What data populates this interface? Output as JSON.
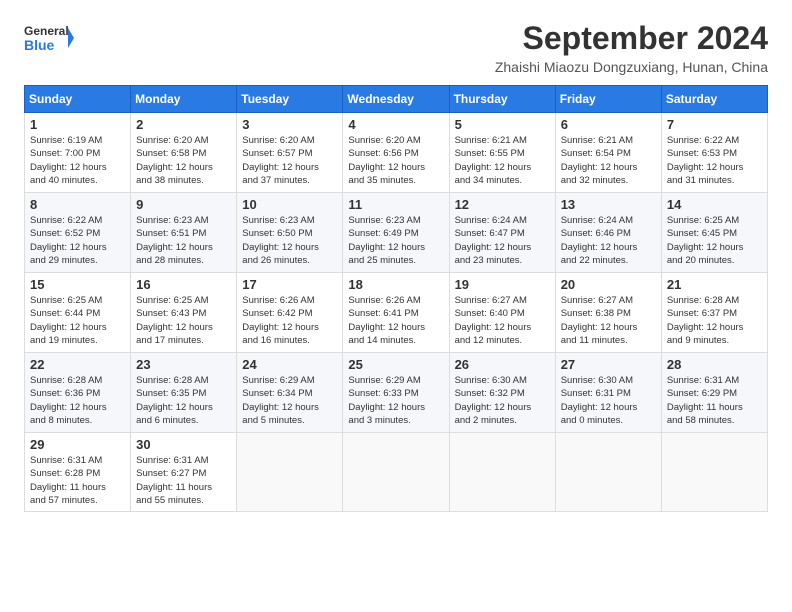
{
  "header": {
    "logo_general": "General",
    "logo_blue": "Blue",
    "month_title": "September 2024",
    "location": "Zhaishi Miaozu Dongzuxiang, Hunan, China"
  },
  "days_of_week": [
    "Sunday",
    "Monday",
    "Tuesday",
    "Wednesday",
    "Thursday",
    "Friday",
    "Saturday"
  ],
  "weeks": [
    [
      {
        "day": "1",
        "info": "Sunrise: 6:19 AM\nSunset: 7:00 PM\nDaylight: 12 hours\nand 40 minutes."
      },
      {
        "day": "2",
        "info": "Sunrise: 6:20 AM\nSunset: 6:58 PM\nDaylight: 12 hours\nand 38 minutes."
      },
      {
        "day": "3",
        "info": "Sunrise: 6:20 AM\nSunset: 6:57 PM\nDaylight: 12 hours\nand 37 minutes."
      },
      {
        "day": "4",
        "info": "Sunrise: 6:20 AM\nSunset: 6:56 PM\nDaylight: 12 hours\nand 35 minutes."
      },
      {
        "day": "5",
        "info": "Sunrise: 6:21 AM\nSunset: 6:55 PM\nDaylight: 12 hours\nand 34 minutes."
      },
      {
        "day": "6",
        "info": "Sunrise: 6:21 AM\nSunset: 6:54 PM\nDaylight: 12 hours\nand 32 minutes."
      },
      {
        "day": "7",
        "info": "Sunrise: 6:22 AM\nSunset: 6:53 PM\nDaylight: 12 hours\nand 31 minutes."
      }
    ],
    [
      {
        "day": "8",
        "info": "Sunrise: 6:22 AM\nSunset: 6:52 PM\nDaylight: 12 hours\nand 29 minutes."
      },
      {
        "day": "9",
        "info": "Sunrise: 6:23 AM\nSunset: 6:51 PM\nDaylight: 12 hours\nand 28 minutes."
      },
      {
        "day": "10",
        "info": "Sunrise: 6:23 AM\nSunset: 6:50 PM\nDaylight: 12 hours\nand 26 minutes."
      },
      {
        "day": "11",
        "info": "Sunrise: 6:23 AM\nSunset: 6:49 PM\nDaylight: 12 hours\nand 25 minutes."
      },
      {
        "day": "12",
        "info": "Sunrise: 6:24 AM\nSunset: 6:47 PM\nDaylight: 12 hours\nand 23 minutes."
      },
      {
        "day": "13",
        "info": "Sunrise: 6:24 AM\nSunset: 6:46 PM\nDaylight: 12 hours\nand 22 minutes."
      },
      {
        "day": "14",
        "info": "Sunrise: 6:25 AM\nSunset: 6:45 PM\nDaylight: 12 hours\nand 20 minutes."
      }
    ],
    [
      {
        "day": "15",
        "info": "Sunrise: 6:25 AM\nSunset: 6:44 PM\nDaylight: 12 hours\nand 19 minutes."
      },
      {
        "day": "16",
        "info": "Sunrise: 6:25 AM\nSunset: 6:43 PM\nDaylight: 12 hours\nand 17 minutes."
      },
      {
        "day": "17",
        "info": "Sunrise: 6:26 AM\nSunset: 6:42 PM\nDaylight: 12 hours\nand 16 minutes."
      },
      {
        "day": "18",
        "info": "Sunrise: 6:26 AM\nSunset: 6:41 PM\nDaylight: 12 hours\nand 14 minutes."
      },
      {
        "day": "19",
        "info": "Sunrise: 6:27 AM\nSunset: 6:40 PM\nDaylight: 12 hours\nand 12 minutes."
      },
      {
        "day": "20",
        "info": "Sunrise: 6:27 AM\nSunset: 6:38 PM\nDaylight: 12 hours\nand 11 minutes."
      },
      {
        "day": "21",
        "info": "Sunrise: 6:28 AM\nSunset: 6:37 PM\nDaylight: 12 hours\nand 9 minutes."
      }
    ],
    [
      {
        "day": "22",
        "info": "Sunrise: 6:28 AM\nSunset: 6:36 PM\nDaylight: 12 hours\nand 8 minutes."
      },
      {
        "day": "23",
        "info": "Sunrise: 6:28 AM\nSunset: 6:35 PM\nDaylight: 12 hours\nand 6 minutes."
      },
      {
        "day": "24",
        "info": "Sunrise: 6:29 AM\nSunset: 6:34 PM\nDaylight: 12 hours\nand 5 minutes."
      },
      {
        "day": "25",
        "info": "Sunrise: 6:29 AM\nSunset: 6:33 PM\nDaylight: 12 hours\nand 3 minutes."
      },
      {
        "day": "26",
        "info": "Sunrise: 6:30 AM\nSunset: 6:32 PM\nDaylight: 12 hours\nand 2 minutes."
      },
      {
        "day": "27",
        "info": "Sunrise: 6:30 AM\nSunset: 6:31 PM\nDaylight: 12 hours\nand 0 minutes."
      },
      {
        "day": "28",
        "info": "Sunrise: 6:31 AM\nSunset: 6:29 PM\nDaylight: 11 hours\nand 58 minutes."
      }
    ],
    [
      {
        "day": "29",
        "info": "Sunrise: 6:31 AM\nSunset: 6:28 PM\nDaylight: 11 hours\nand 57 minutes."
      },
      {
        "day": "30",
        "info": "Sunrise: 6:31 AM\nSunset: 6:27 PM\nDaylight: 11 hours\nand 55 minutes."
      },
      {
        "day": "",
        "info": ""
      },
      {
        "day": "",
        "info": ""
      },
      {
        "day": "",
        "info": ""
      },
      {
        "day": "",
        "info": ""
      },
      {
        "day": "",
        "info": ""
      }
    ]
  ]
}
